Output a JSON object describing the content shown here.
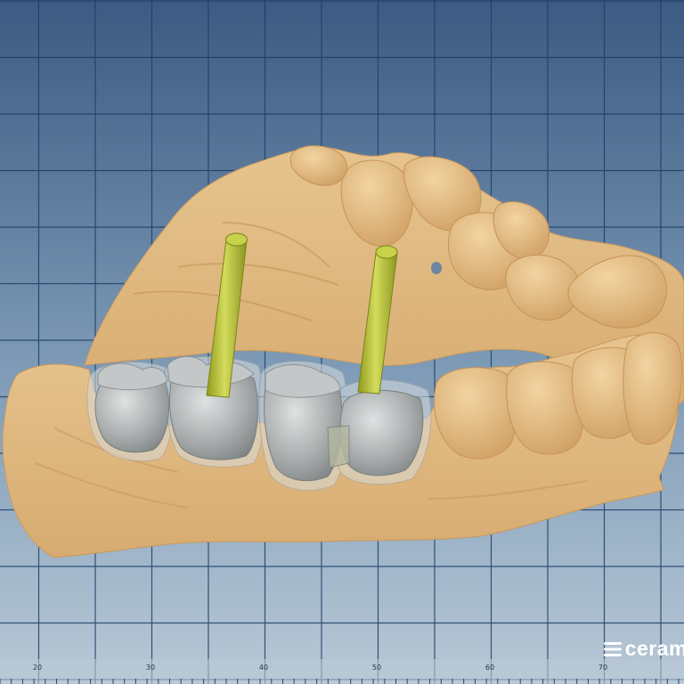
{
  "ruler": {
    "labels": [
      "20",
      "30",
      "40",
      "50",
      "60",
      "70"
    ]
  },
  "brand": {
    "text": "ceram"
  },
  "colors": {
    "background_top": "#3c5a82",
    "background_bottom": "#b3c4d4",
    "grid": "#1d3d66",
    "model_stone": "#e2bb84",
    "crown_gray": "#a9adad",
    "implant_post": "#b9c33a",
    "brand": "#ffffff"
  },
  "icons": {
    "brand_mark": "ceramill-logo-icon"
  }
}
